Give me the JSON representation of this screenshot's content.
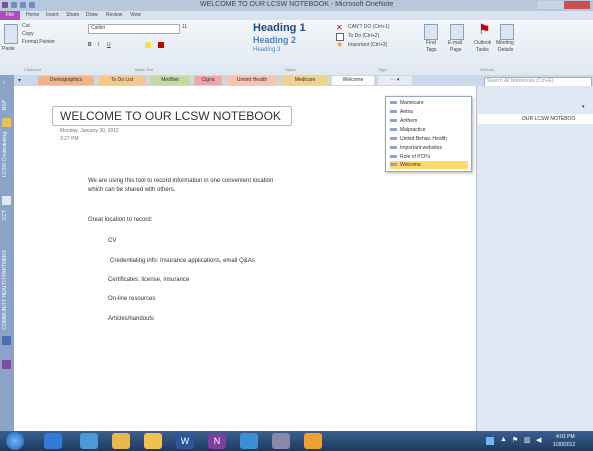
{
  "window": {
    "title": "WELCOME TO OUR LCSW NOTEBOOK - Microsoft OneNote"
  },
  "ribbon_tabs": [
    "File",
    "Home",
    "Insert",
    "Share",
    "Draw",
    "Review",
    "View"
  ],
  "clipboard": {
    "cut": "Cut",
    "copy": "Copy",
    "paste": "Paste",
    "format_painter": "Format Painter",
    "label": "Clipboard"
  },
  "font": {
    "name": "Calibri",
    "size": "11",
    "label": "Basic Text"
  },
  "styles": {
    "h1": "Heading 1",
    "h2": "Heading 2",
    "h3": "Heading 3",
    "label": "Styles"
  },
  "tags": {
    "t1": "CAN'T DO (Ctrl+1)",
    "t2": "To Do (Ctrl+2)",
    "t3": "Important (Ctrl+3)",
    "label": "Tags"
  },
  "find": {
    "find": "Find",
    "tags": "Tags"
  },
  "outlook": {
    "email": "E-mail",
    "page": "Page",
    "outlook_tasks": "Outlook",
    "tasks": "Tasks",
    "meeting": "Meeting",
    "details": "Details",
    "label": "Outlook"
  },
  "sections": [
    "Demographics",
    "To Do List",
    "MedNet",
    "Cigna",
    "United Health",
    "Medicare",
    "Welcome"
  ],
  "search_placeholder": "Search All Notebooks (Ctrl+E)",
  "left_tabs": [
    "NSP",
    "LCSW Credentialing",
    "CCT",
    "COMMUNITY HEALTH PARTNERS"
  ],
  "dropdown": [
    "Mamecare",
    "Aetna",
    "Anthem",
    "Malpractice",
    "United Behav. Health",
    "Important websites",
    "Role of PCPs",
    "Welcome"
  ],
  "page": {
    "title": "WELCOME TO OUR LCSW NOTEBOOK",
    "date": "Monday, January 30, 2012",
    "time": "3:27 PM",
    "intro_line1": "We are using this tool to record information in one convenient location",
    "intro_line2": "which can be shared with others.",
    "great_location": "Great location to record:",
    "items": [
      "CV",
      "Credentialing info: Insurance applications, email Q&As",
      "Certificates: license, insurance",
      "On-line resources",
      "Articles/handouts"
    ]
  },
  "pane_title": "OUR LCSW NOTEBOO",
  "clock": {
    "time": "4:01 PM",
    "date": "1/30/2012"
  },
  "colors": {
    "accent": "#1f497d",
    "file_tab": "#b04cc0",
    "taskbar": "#1e3a5f"
  }
}
